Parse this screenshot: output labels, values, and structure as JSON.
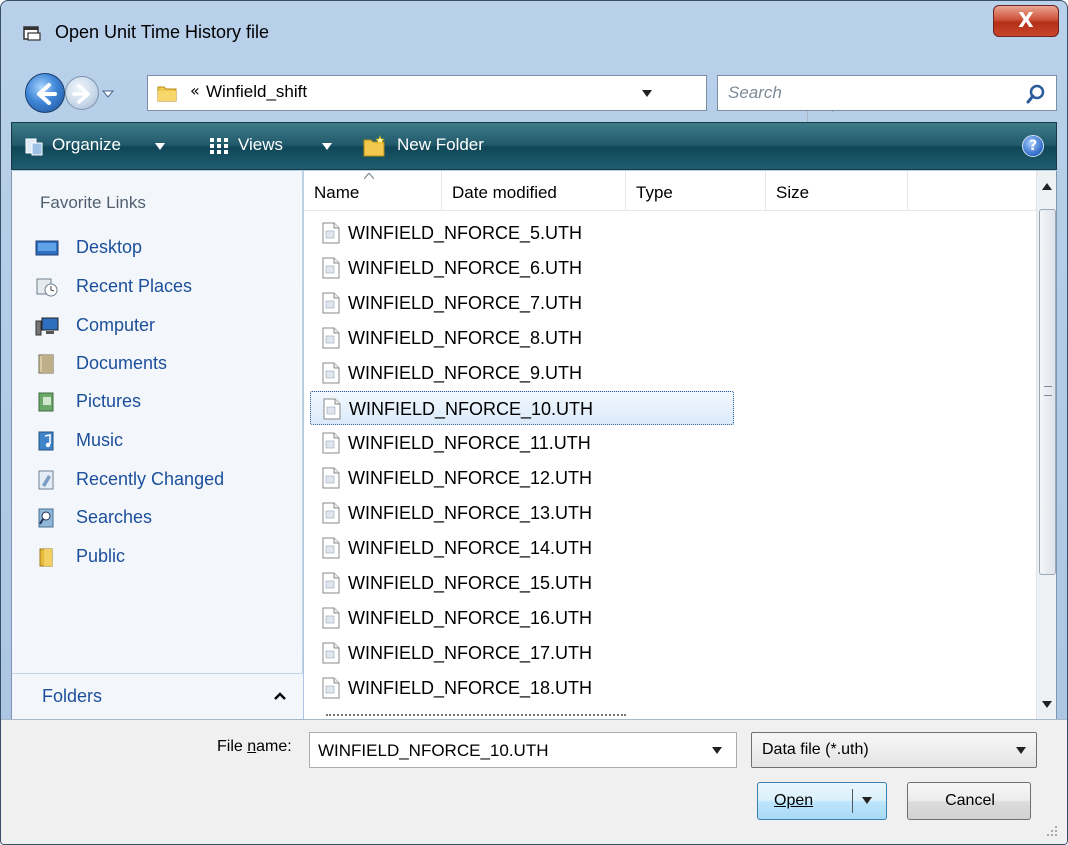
{
  "window": {
    "title": "Open Unit Time History file",
    "close_label": "X"
  },
  "address": {
    "chevron": "«",
    "path": "Winfield_shift"
  },
  "search": {
    "placeholder": "Search"
  },
  "toolbar": {
    "organize": "Organize",
    "views": "Views",
    "new_folder": "New Folder",
    "help": "?"
  },
  "favorites": {
    "title": "Favorite Links",
    "items": [
      {
        "label": "Desktop",
        "icon": "desktop-icon"
      },
      {
        "label": "Recent Places",
        "icon": "recent-places-icon"
      },
      {
        "label": "Computer",
        "icon": "computer-icon"
      },
      {
        "label": "Documents",
        "icon": "documents-icon"
      },
      {
        "label": "Pictures",
        "icon": "pictures-icon"
      },
      {
        "label": "Music",
        "icon": "music-icon"
      },
      {
        "label": "Recently Changed",
        "icon": "recently-changed-icon"
      },
      {
        "label": "Searches",
        "icon": "searches-icon"
      },
      {
        "label": "Public",
        "icon": "public-folder-icon"
      }
    ],
    "folders_label": "Folders"
  },
  "columns": {
    "name": "Name",
    "date_modified": "Date modified",
    "type": "Type",
    "size": "Size"
  },
  "files": [
    "WINFIELD_NFORCE_5.UTH",
    "WINFIELD_NFORCE_6.UTH",
    "WINFIELD_NFORCE_7.UTH",
    "WINFIELD_NFORCE_8.UTH",
    "WINFIELD_NFORCE_9.UTH",
    "WINFIELD_NFORCE_10.UTH",
    "WINFIELD_NFORCE_11.UTH",
    "WINFIELD_NFORCE_12.UTH",
    "WINFIELD_NFORCE_13.UTH",
    "WINFIELD_NFORCE_14.UTH",
    "WINFIELD_NFORCE_15.UTH",
    "WINFIELD_NFORCE_16.UTH",
    "WINFIELD_NFORCE_17.UTH",
    "WINFIELD_NFORCE_18.UTH"
  ],
  "selected_file_index": 5,
  "bottom": {
    "filename_label_pre": "File ",
    "filename_label_u": "n",
    "filename_label_post": "ame:",
    "filename_value": "WINFIELD_NFORCE_10.UTH",
    "filetype_value": "Data file (*.uth)",
    "open_label": "Open",
    "cancel_label": "Cancel"
  },
  "colors": {
    "link_blue": "#1c4f9b",
    "toolbar_teal": "#21596a",
    "close_red": "#c9462a"
  }
}
